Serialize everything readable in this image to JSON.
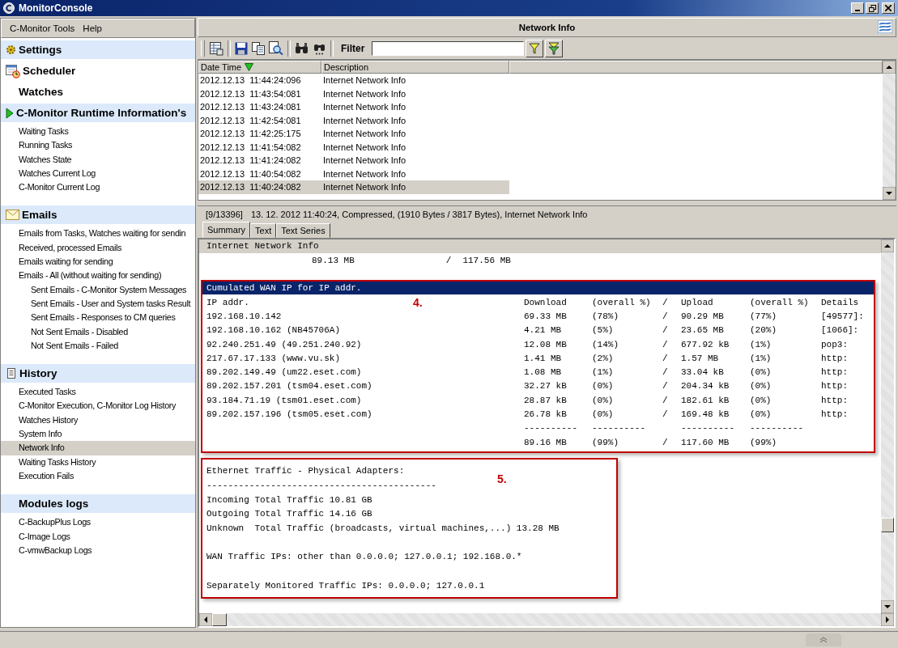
{
  "window": {
    "title": "MonitorConsole"
  },
  "menu": [
    "C-Monitor Tools",
    "Help"
  ],
  "sidebar": [
    {
      "title": "Settings",
      "band": true
    },
    {
      "title": "Scheduler",
      "band": false
    },
    {
      "title": "Watches",
      "band": false
    },
    {
      "title": "C-Monitor Runtime Information's",
      "band": true,
      "items": [
        {
          "label": "Waiting Tasks",
          "selected": false
        },
        {
          "label": "Running Tasks",
          "selected": false
        },
        {
          "label": "Watches State",
          "selected": false
        },
        {
          "label": "Watches Current Log",
          "selected": false
        },
        {
          "label": "C-Monitor Current Log",
          "selected": false
        }
      ]
    },
    {
      "title": "Emails",
      "band": true,
      "items": [
        {
          "label": "Emails from Tasks, Watches waiting for sendin",
          "selected": false
        },
        {
          "label": "Received, processed Emails",
          "selected": false
        },
        {
          "label": "Emails waiting for sending",
          "selected": false
        },
        {
          "label": "Emails - All (without waiting for sending)",
          "selected": false,
          "children": [
            {
              "label": "Sent Emails - C-Monitor System Messages",
              "selected": false
            },
            {
              "label": "Sent Emails - User and System tasks Result",
              "selected": false
            },
            {
              "label": "Sent Emails - Responses to CM queries",
              "selected": false
            },
            {
              "label": "Not Sent Emails - Disabled",
              "selected": false
            },
            {
              "label": "Not Sent Emails - Failed",
              "selected": false
            }
          ]
        }
      ]
    },
    {
      "title": "History",
      "band": true,
      "items": [
        {
          "label": "Executed Tasks",
          "selected": false
        },
        {
          "label": "C-Monitor Execution, C-Monitor Log History",
          "selected": false
        },
        {
          "label": "Watches History",
          "selected": false
        },
        {
          "label": "System Info",
          "selected": false
        },
        {
          "label": "Network Info",
          "selected": true
        },
        {
          "label": "Waiting Tasks History",
          "selected": false
        },
        {
          "label": "Execution Fails",
          "selected": false
        }
      ]
    },
    {
      "title": "Modules logs",
      "band": true,
      "items": [
        {
          "label": "C-BackupPlus Logs",
          "selected": false
        },
        {
          "label": "C-Image Logs",
          "selected": false
        },
        {
          "label": "C-vmwBackup Logs",
          "selected": false
        }
      ]
    }
  ],
  "panel": {
    "title": "Network Info"
  },
  "toolbar": {
    "filter_label": "Filter"
  },
  "table": {
    "columns": [
      {
        "label": "Date Time",
        "sorted": true
      },
      {
        "label": "Description",
        "sorted": false
      }
    ],
    "rows": [
      {
        "date_time": "2012.12.13  11:44:24:096",
        "description": "Internet Network Info",
        "selected": false
      },
      {
        "date_time": "2012.12.13  11:43:54:081",
        "description": "Internet Network Info",
        "selected": false
      },
      {
        "date_time": "2012.12.13  11:43:24:081",
        "description": "Internet Network Info",
        "selected": false
      },
      {
        "date_time": "2012.12.13  11:42:54:081",
        "description": "Internet Network Info",
        "selected": false
      },
      {
        "date_time": "2012.12.13  11:42:25:175",
        "description": "Internet Network Info",
        "selected": false
      },
      {
        "date_time": "2012.12.13  11:41:54:082",
        "description": "Internet Network Info",
        "selected": false
      },
      {
        "date_time": "2012.12.13  11:41:24:082",
        "description": "Internet Network Info",
        "selected": false
      },
      {
        "date_time": "2012.12.13  11:40:54:082",
        "description": "Internet Network Info",
        "selected": false
      },
      {
        "date_time": "2012.12.13  11:40:24:082",
        "description": "Internet Network Info",
        "selected": true
      }
    ]
  },
  "record_info": {
    "index": "[9/13396]",
    "summary": "13. 12. 2012 11:40:24, Compressed, (1910 Bytes / 3817 Bytes), Internet Network Info"
  },
  "tabs": [
    {
      "label": "Summary",
      "selected": true
    },
    {
      "label": "Text",
      "selected": false
    },
    {
      "label": "Text Series",
      "selected": false
    }
  ],
  "report": {
    "title": "Internet Network Info",
    "totals": {
      "download": "89.13 MB",
      "sep": "/",
      "upload": "117.56 MB"
    },
    "wan_section": {
      "marker": "4.",
      "title": "Cumulated WAN IP for IP addr.",
      "header": {
        "ip": "IP addr.",
        "download": "Download",
        "download_pct": "(overall %)",
        "sep": "/",
        "upload": "Upload",
        "upload_pct": "(overall %)",
        "details": "Details"
      },
      "rows": [
        {
          "ip": "192.168.10.142",
          "download": "69.33 MB",
          "download_pct": "(78%)",
          "sep": "/",
          "upload": "90.29 MB",
          "upload_pct": "(77%)",
          "details": "[49577]:"
        },
        {
          "ip": "192.168.10.162 (NB45706A)",
          "download": "4.21 MB",
          "download_pct": "(5%)",
          "sep": "/",
          "upload": "23.65 MB",
          "upload_pct": "(20%)",
          "details": "[1066]:"
        },
        {
          "ip": "92.240.251.49 (49.251.240.92)",
          "download": "12.08 MB",
          "download_pct": "(14%)",
          "sep": "/",
          "upload": "677.92 kB",
          "upload_pct": "(1%)",
          "details": "pop3:"
        },
        {
          "ip": "217.67.17.133 (www.vu.sk)",
          "download": "1.41 MB",
          "download_pct": "(2%)",
          "sep": "/",
          "upload": "1.57 MB",
          "upload_pct": "(1%)",
          "details": "http:"
        },
        {
          "ip": "89.202.149.49 (um22.eset.com)",
          "download": "1.08 MB",
          "download_pct": "(1%)",
          "sep": "/",
          "upload": "33.04 kB",
          "upload_pct": "(0%)",
          "details": "http:"
        },
        {
          "ip": "89.202.157.201 (tsm04.eset.com)",
          "download": "32.27 kB",
          "download_pct": "(0%)",
          "sep": "/",
          "upload": "204.34 kB",
          "upload_pct": "(0%)",
          "details": "http:"
        },
        {
          "ip": "93.184.71.19 (tsm01.eset.com)",
          "download": "28.87 kB",
          "download_pct": "(0%)",
          "sep": "/",
          "upload": "182.61 kB",
          "upload_pct": "(0%)",
          "details": "http:"
        },
        {
          "ip": "89.202.157.196 (tsm05.eset.com)",
          "download": "26.78 kB",
          "download_pct": "(0%)",
          "sep": "/",
          "upload": "169.48 kB",
          "upload_pct": "(0%)",
          "details": "http:"
        },
        {
          "download": "----------",
          "download_pct": "----------",
          "upload": "----------",
          "upload_pct": "----------"
        },
        {
          "download": "89.16 MB",
          "download_pct": "(99%)",
          "sep": "/",
          "upload": "117.60 MB",
          "upload_pct": "(99%)"
        }
      ]
    },
    "ethernet_section": {
      "marker": "5.",
      "lines": [
        {
          "text": "Ethernet Traffic - Physical Adapters:",
          "spaced": false
        },
        {
          "text": "-------------------------------------------",
          "spaced": false
        },
        {
          "text": "Incoming Total Traffic 10.81 GB",
          "spaced": false
        },
        {
          "text": "Outgoing Total Traffic 14.16 GB",
          "spaced": false
        },
        {
          "text": "Unknown  Total Traffic (broadcasts, virtual machines,...) 13.28 MB",
          "spaced": false
        },
        {
          "text": "WAN Traffic IPs: other than 0.0.0.0; 127.0.0.1; 192.168.0.*",
          "spaced": true
        },
        {
          "text": "Separately Monitored Traffic IPs: 0.0.0.0; 127.0.0.1",
          "spaced": true
        }
      ]
    }
  }
}
